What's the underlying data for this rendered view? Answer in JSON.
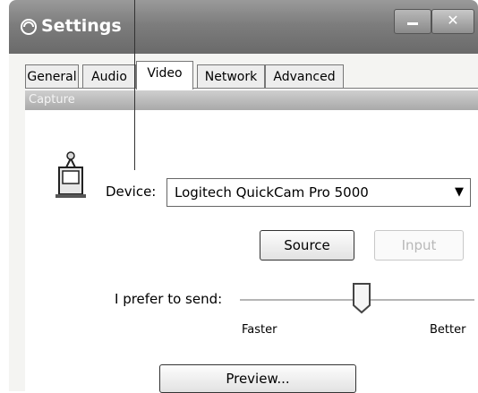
{
  "window": {
    "title": "Settings"
  },
  "tabs": [
    {
      "label": "General",
      "active": false
    },
    {
      "label": "Audio",
      "active": false
    },
    {
      "label": "Video",
      "active": true
    },
    {
      "label": "Network",
      "active": false
    },
    {
      "label": "Advanced",
      "active": false
    }
  ],
  "capture": {
    "group_label": "Capture",
    "device_label": "Device:",
    "device_value": "Logitech QuickCam Pro 5000",
    "source_button": "Source",
    "input_button": "Input",
    "prefer_label": "I prefer to send:",
    "slider_min_label": "Faster",
    "slider_max_label": "Better",
    "slider_value_fraction": 0.52,
    "preview_button": "Preview..."
  },
  "icons": {
    "app": "settings-swirl-icon",
    "device": "webcam-icon",
    "minimize": "minimize-icon",
    "close": "close-icon",
    "dropdown": "chevron-down-icon"
  },
  "colors": {
    "titlebar": "#7d7d7d",
    "group_header": "#b9b9b9",
    "panel": "#ffffff"
  }
}
